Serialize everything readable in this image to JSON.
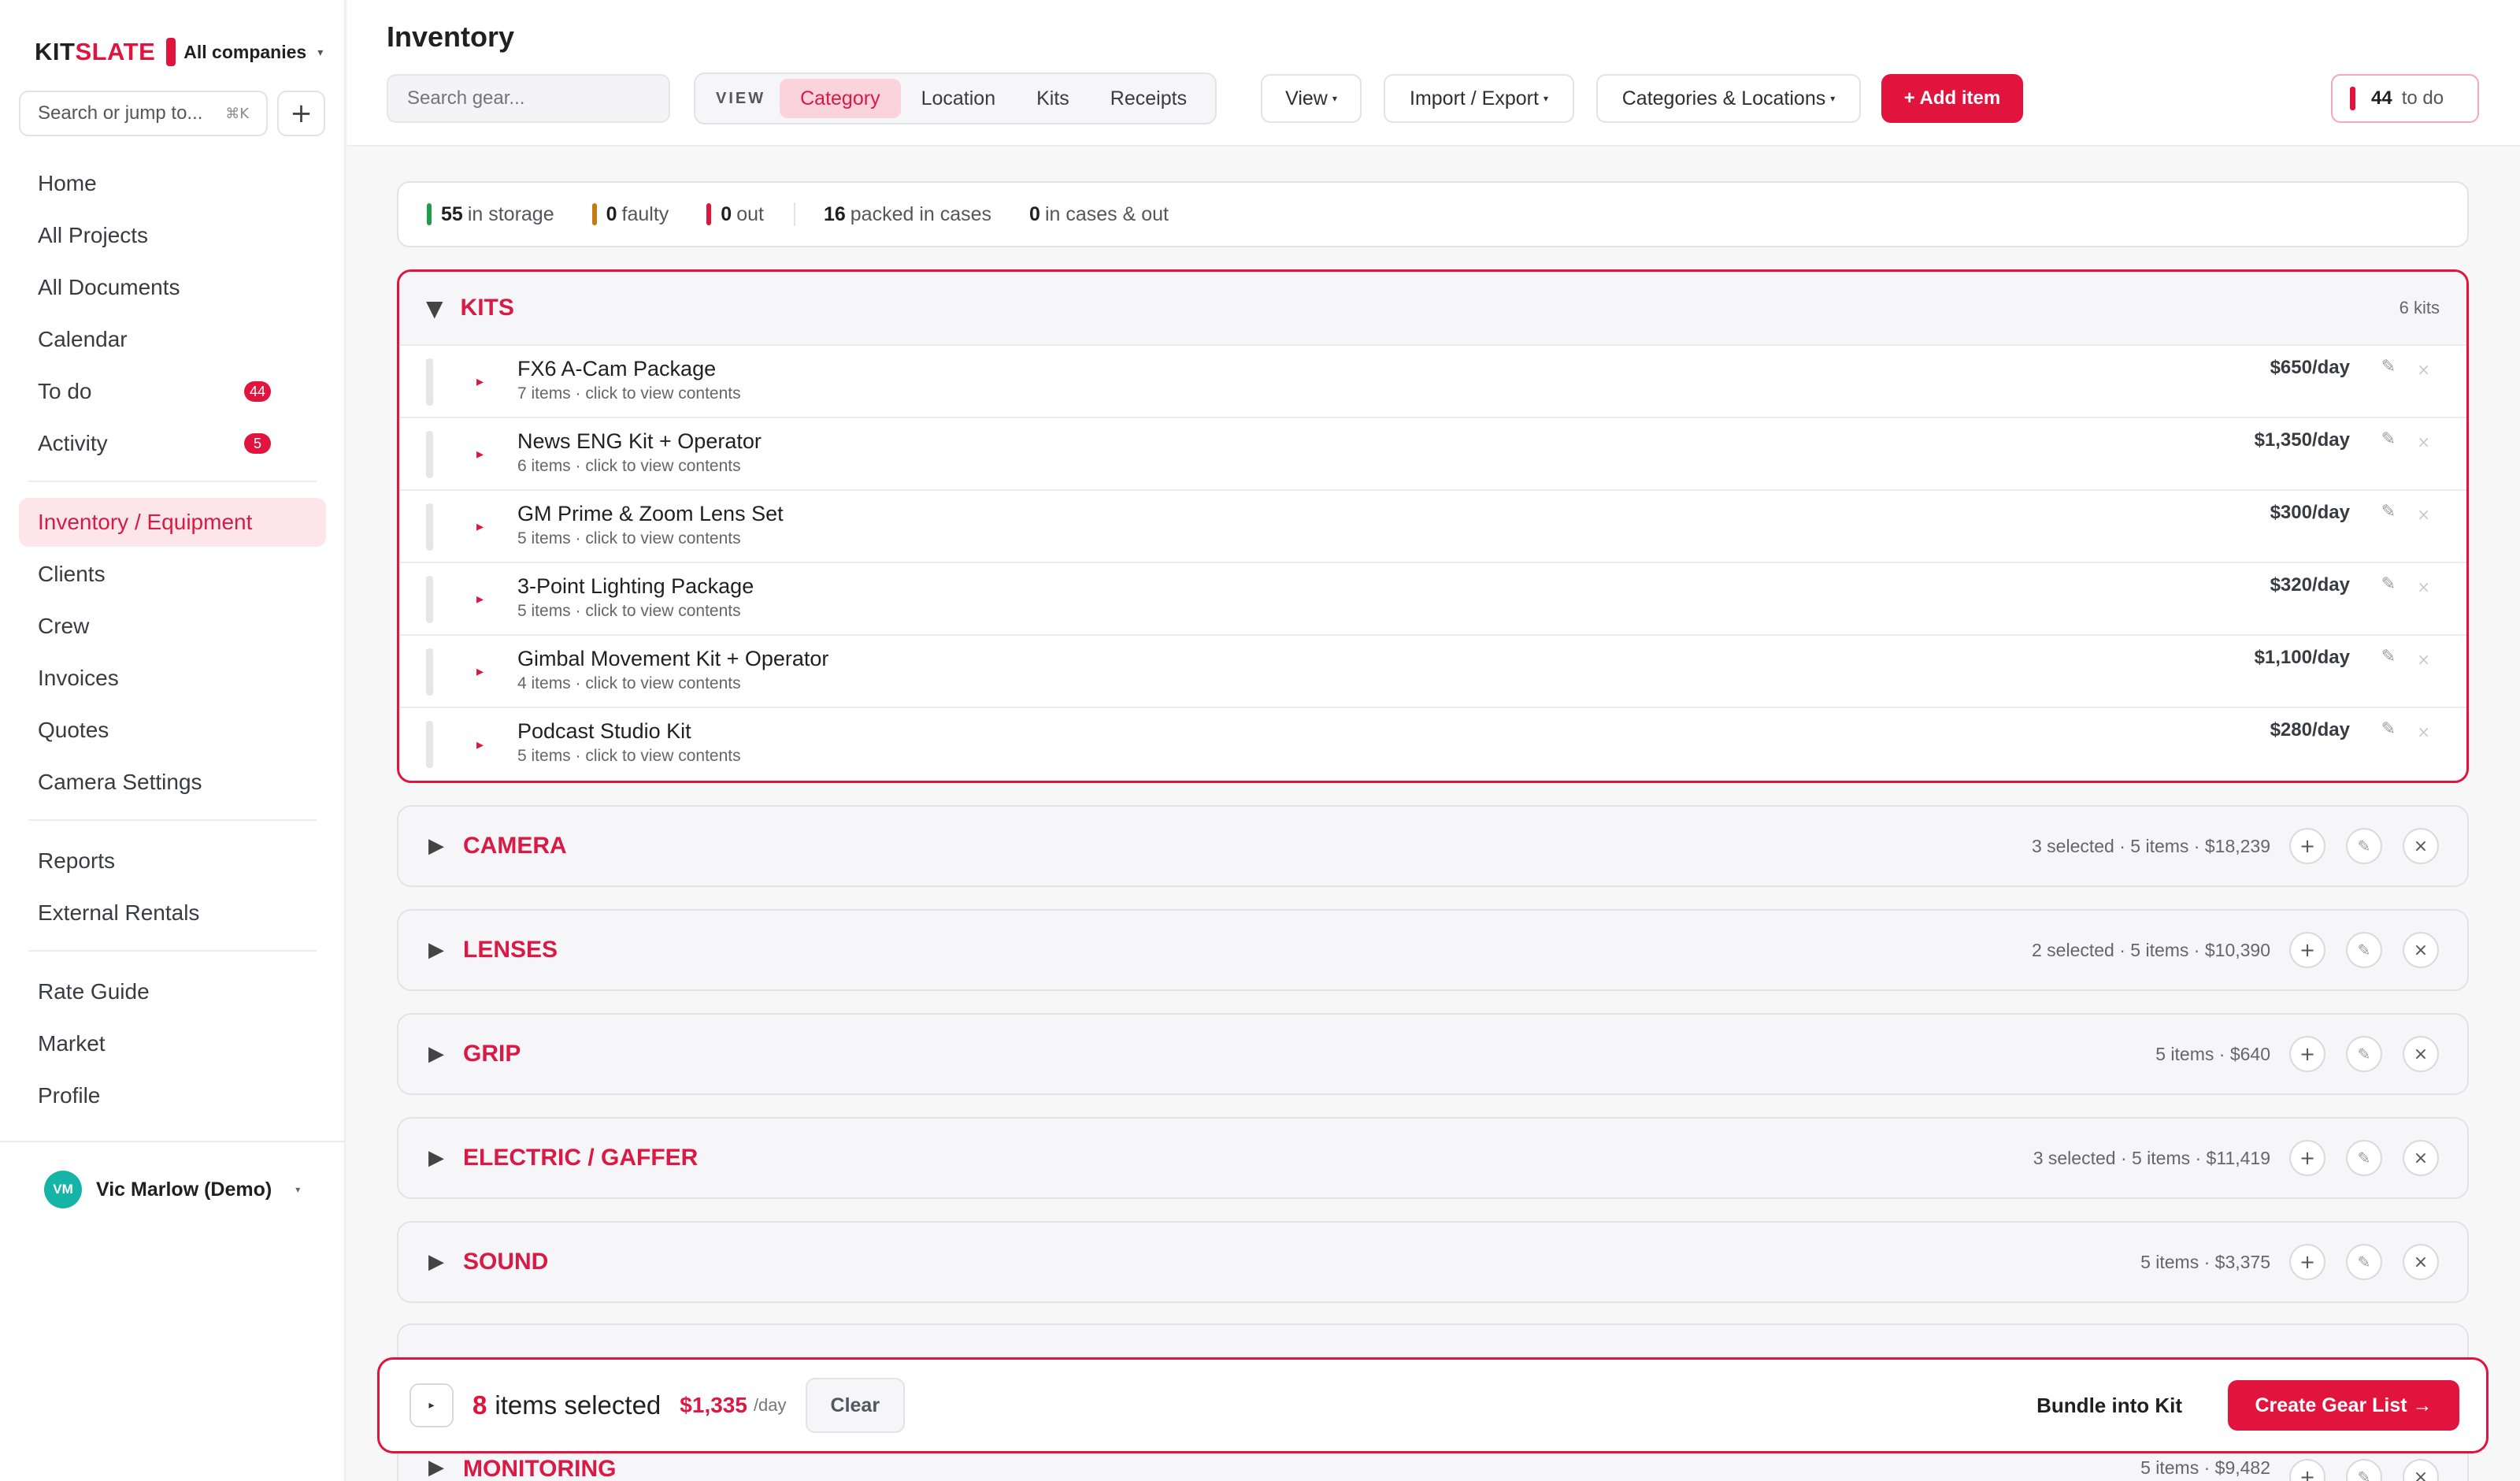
{
  "brand": {
    "logo_a": "KIT",
    "logo_b": "SLATE",
    "company": "All companies",
    "caret": "▾"
  },
  "sidebar": {
    "search_label": "Search or jump to...",
    "search_shortcut": "⌘K",
    "plus": "+",
    "group1": [
      {
        "label": "Home"
      },
      {
        "label": "All Projects"
      },
      {
        "label": "All Documents"
      },
      {
        "label": "Calendar"
      },
      {
        "label": "To do",
        "badge": "44"
      },
      {
        "label": "Activity",
        "badge": "5"
      }
    ],
    "group2": [
      {
        "label": "Inventory / Equipment",
        "active": true
      },
      {
        "label": "Clients"
      },
      {
        "label": "Crew"
      },
      {
        "label": "Invoices"
      },
      {
        "label": "Quotes"
      },
      {
        "label": "Camera Settings"
      }
    ],
    "group3": [
      {
        "label": "Reports"
      },
      {
        "label": "External Rentals"
      }
    ],
    "group4": [
      {
        "label": "Rate Guide"
      },
      {
        "label": "Market"
      },
      {
        "label": "Profile"
      }
    ],
    "user": {
      "initials": "VM",
      "name": "Vic Marlow (Demo)",
      "caret": "▾"
    }
  },
  "header": {
    "title": "Inventory",
    "search_placeholder": "Search gear...",
    "view_label": "VIEW",
    "tabs": [
      {
        "label": "Category",
        "active": true
      },
      {
        "label": "Location"
      },
      {
        "label": "Kits"
      },
      {
        "label": "Receipts"
      }
    ],
    "view_btn": "View",
    "import_btn": "Import / Export",
    "catloc_btn": "Categories & Locations",
    "caret": "▾",
    "add_btn": "+ Add item",
    "todo_count": "44",
    "todo_label": "to do"
  },
  "stats": {
    "storage_n": "55",
    "storage_label": "in storage",
    "storage_color": "#1f9d4a",
    "faulty_n": "0",
    "faulty_label": "faulty",
    "faulty_color": "#c77a12",
    "out_n": "0",
    "out_label": "out",
    "out_color": "#e0143c",
    "packed_n": "16",
    "packed_label": "packed in cases",
    "casesout_n": "0",
    "casesout_label": "in cases & out"
  },
  "kits": {
    "title": "KITS",
    "count": "6 kits",
    "items": [
      {
        "name": "FX6 A-Cam Package",
        "sub": "7 items · click to view contents",
        "price": "$650/day"
      },
      {
        "name": "News ENG Kit + Operator",
        "sub": "6 items · click to view contents",
        "price": "$1,350/day"
      },
      {
        "name": "GM Prime & Zoom Lens Set",
        "sub": "5 items · click to view contents",
        "price": "$300/day"
      },
      {
        "name": "3-Point Lighting Package",
        "sub": "5 items · click to view contents",
        "price": "$320/day"
      },
      {
        "name": "Gimbal Movement Kit + Operator",
        "sub": "4 items · click to view contents",
        "price": "$1,100/day"
      },
      {
        "name": "Podcast Studio Kit",
        "sub": "5 items · click to view contents",
        "price": "$280/day"
      }
    ]
  },
  "categories": [
    {
      "title": "CAMERA",
      "meta": "3 selected · 5 items · $18,239"
    },
    {
      "title": "LENSES",
      "meta": "2 selected · 5 items · $10,390"
    },
    {
      "title": "GRIP",
      "meta": "5 items · $640"
    },
    {
      "title": "ELECTRIC / GAFFER",
      "meta": "3 selected · 5 items · $11,419"
    },
    {
      "title": "SOUND",
      "meta": "5 items · $3,375"
    }
  ],
  "monitoring": {
    "title": "MONITORING",
    "meta": "5 items · $9,482"
  },
  "icons": {
    "tri_right": "▶",
    "tri_down": "▼",
    "small_tri": "▸",
    "pencil": "✎",
    "close": "×",
    "plus": "+"
  },
  "selection": {
    "count": "8",
    "label": "items selected",
    "price": "$1,335",
    "per": "/day",
    "clear": "Clear",
    "bundle": "Bundle into Kit",
    "create": "Create Gear List →"
  },
  "colors": {
    "accent": "#e0143c",
    "accent_soft": "#fde6ea",
    "avatar": "#16b4a6"
  }
}
